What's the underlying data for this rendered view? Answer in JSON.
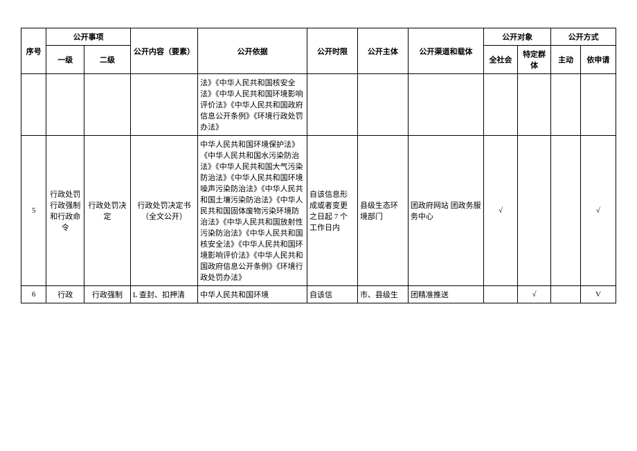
{
  "headers": {
    "seq": "序号",
    "matter": "公开事项",
    "lvl1": "一级",
    "lvl2": "二级",
    "content": "公开内容（要素）",
    "basis": "公开依据",
    "time": "公开时限",
    "subject": "公开主体",
    "channel": "公开渠道和载体",
    "target": "公开对象",
    "all": "全社会",
    "spec": "特定群体",
    "method": "公开方式",
    "active": "主动",
    "apply": "依申请"
  },
  "rows": [
    {
      "seq": "",
      "lvl1": "",
      "lvl2": "",
      "content": "",
      "basis": "法》《中华人民共和国核安全法》《中华人民共和国环境影响评价法》《中华人民共和国政府信息公开条例》《环境行政处罚办法》",
      "time": "",
      "subject": "",
      "channel": "",
      "all": "",
      "spec": "",
      "active": "",
      "apply": ""
    },
    {
      "seq": "5",
      "lvl1": "行政处罚行政强制和行政命令",
      "lvl2": "行政处罚决定",
      "content": "行政处罚决定书（全文公开）",
      "basis": "中华人民共和国环境保护法》《中华人民共和国水污染防治法》《中华人民共和国大气污染防治法》《中华人民共和国环境噪声污染防治法》《中华人民共和国土壤污染防治法》《中华人民共和国固体废物污染环境防治法》《中华人民共和国放射性污染防治法》《中华人民共和国核安全法》《中华人民共和国环境影响评价法》《中华人民共和国政府信息公开条例》《环境行政处罚办法》",
      "time": "自该信息形成或者变更之日起 7 个工作日内",
      "subject": "县级生态环境部门",
      "channel": "团政府网站\n团政务服务中心",
      "all": "√",
      "spec": "",
      "active": "",
      "apply": "√"
    },
    {
      "seq": "6",
      "lvl1": "行政",
      "lvl2": "行政强制",
      "content": "L 查封、扣押清",
      "basis": "中华人民共和国环境",
      "time": "自该信",
      "subject": "市、县级生",
      "channel": "团精准推送",
      "all": "",
      "spec": "√",
      "active": "",
      "apply": "V"
    }
  ]
}
